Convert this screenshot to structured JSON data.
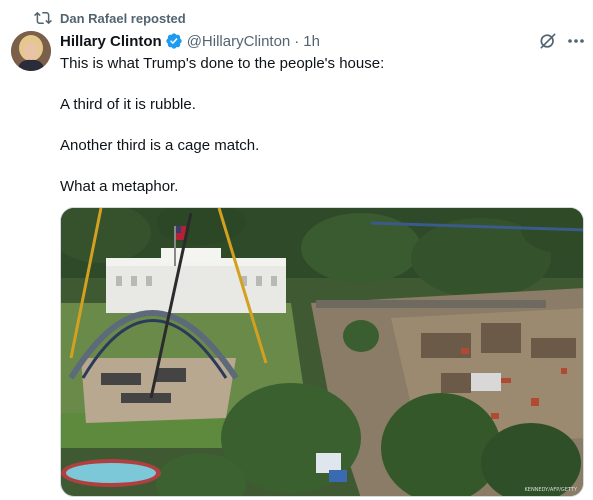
{
  "repost": {
    "text": "Dan Rafael reposted",
    "icon": "repost-icon"
  },
  "author": {
    "name": "Hillary Clinton",
    "handle": "@HillaryClinton",
    "separator": "·",
    "time": "1h",
    "verified_color": "#1d9bf0",
    "avatar": "avatar-photo"
  },
  "tweet": {
    "lines": [
      "This is what Trump's done to the people's house:",
      "A third of it is rubble.",
      "Another third is a cage match.",
      "What a metaphor."
    ]
  },
  "media": {
    "type": "photo",
    "credit": "KENNEDY/AFP/GETTY"
  },
  "colors": {
    "text": "#0f1419",
    "secondary": "#536471",
    "accent": "#1d9bf0"
  }
}
